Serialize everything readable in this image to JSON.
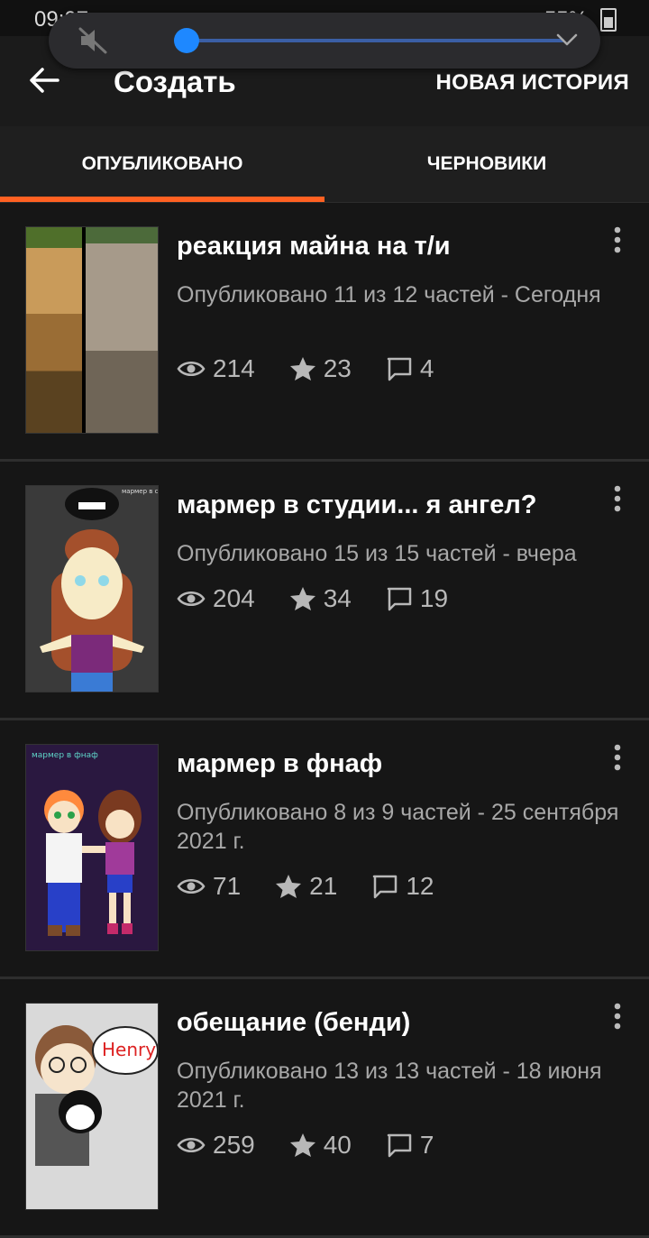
{
  "status_bar": {
    "time": "09:07",
    "battery": "55%"
  },
  "app_bar": {
    "title": "Создать",
    "new_story": "НОВАЯ ИСТОРИЯ"
  },
  "tabs": {
    "published": "ОПУБЛИКОВАНО",
    "drafts": "ЧЕРНОВИКИ"
  },
  "volume": {
    "level": 0.0
  },
  "stories": [
    {
      "title": "реакция майна на т/и",
      "meta": "Опубликовано 11 из 12 частей - Сегодня",
      "views": "214",
      "votes": "23",
      "comments": "4"
    },
    {
      "title": "мармер в студии... я ангел?",
      "meta": "Опубликовано 15 из 15 частей - вчера",
      "views": "204",
      "votes": "34",
      "comments": "19"
    },
    {
      "title": "мармер в фнаф",
      "meta": "Опубликовано 8 из 9 частей - 25 сентября 2021 г.",
      "views": "71",
      "votes": "21",
      "comments": "12"
    },
    {
      "title": "обещание (бенди)",
      "meta": "Опубликовано 13 из 13 частей - 18 июня 2021 г.",
      "views": "259",
      "votes": "40",
      "comments": "7"
    }
  ],
  "cover_texts": {
    "story2": "мармер в студии... я ангел?",
    "story3": "мармер в фнаф",
    "story4": "Henry"
  },
  "colors": {
    "accent": "#ff6122",
    "background": "#121212",
    "volume_thumb": "#1e88ff"
  }
}
